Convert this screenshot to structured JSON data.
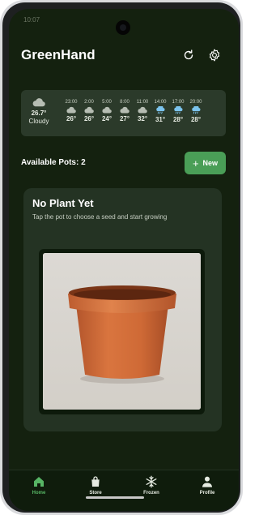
{
  "status_bar": {
    "time": "10:07"
  },
  "header": {
    "title": "GreenHand",
    "refresh_icon": "refresh-icon",
    "settings_icon": "gear-icon"
  },
  "weather": {
    "current": {
      "temp": "26.7°",
      "condition": "Cloudy",
      "icon": "cloud-icon"
    },
    "hourly": [
      {
        "time": "23:00",
        "temp": "26°",
        "icon": "cloud-icon"
      },
      {
        "time": "2:00",
        "temp": "26°",
        "icon": "cloud-icon"
      },
      {
        "time": "5:00",
        "temp": "24°",
        "icon": "cloud-icon"
      },
      {
        "time": "8:00",
        "temp": "27°",
        "icon": "cloud-icon"
      },
      {
        "time": "11:00",
        "temp": "32°",
        "icon": "cloud-icon"
      },
      {
        "time": "14:00",
        "temp": "31°",
        "icon": "rain-icon"
      },
      {
        "time": "17:00",
        "temp": "28°",
        "icon": "rain-icon"
      },
      {
        "time": "20:00",
        "temp": "28°",
        "icon": "rain-icon"
      }
    ]
  },
  "pots": {
    "available_label": "Available Pots: 2",
    "new_button": "New"
  },
  "card": {
    "title": "No Plant Yet",
    "subtitle": "Tap the pot to choose a seed and start growing"
  },
  "nav": [
    {
      "label": "Home",
      "icon": "home-icon",
      "active": true
    },
    {
      "label": "Store",
      "icon": "shopping-bag-icon",
      "active": false
    },
    {
      "label": "Frozen",
      "icon": "snowflake-icon",
      "active": false
    },
    {
      "label": "Profile",
      "icon": "person-icon",
      "active": false
    }
  ],
  "colors": {
    "background": "#14210f",
    "accent": "#4a9e57",
    "nav_active": "#57b565",
    "rain_icon": "#7cc4ee",
    "cloud_icon": "#b6bdb3"
  }
}
